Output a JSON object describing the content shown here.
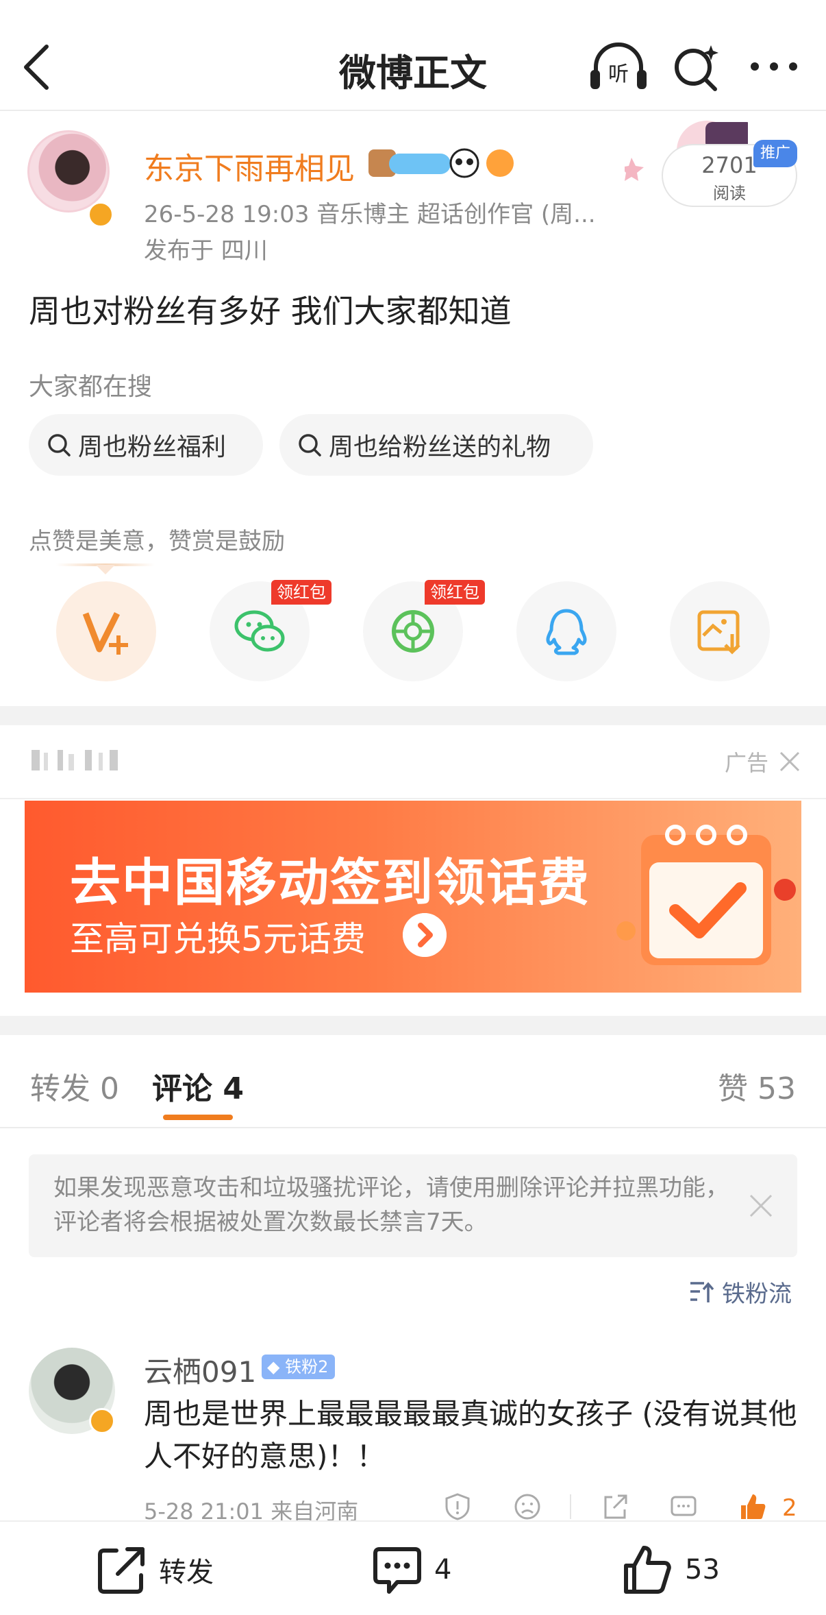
{
  "header": {
    "title": "微博正文",
    "icons": [
      "back-icon",
      "listen-icon",
      "search-spark-icon",
      "more-icon"
    ],
    "listen_glyph": "听"
  },
  "author": {
    "name": "东京下雨再相见",
    "timestamp_source": "26-5-28 19:03  音乐博主 超话创作官 (周...",
    "location": "发布于 四川",
    "reads_count": "2701",
    "reads_label": "阅读",
    "promo_tag": "推广"
  },
  "post": {
    "text": "周也对粉丝有多好 我们大家都知道"
  },
  "search": {
    "heading": "大家都在搜",
    "chips": [
      "周也粉丝福利",
      "周也给粉丝送的礼物"
    ]
  },
  "reward": {
    "text": "点赞是美意，赞赏是鼓励",
    "share_targets": [
      "v-plus-reward-icon",
      "wechat-icon",
      "moments-icon",
      "qq-icon",
      "save-image-icon"
    ],
    "red_packet_label": "领红包"
  },
  "ad": {
    "label": "广告",
    "title": "去中国移动签到领话费",
    "subtitle": "至高可兑换5元话费"
  },
  "tabs": {
    "repost": "转发 0",
    "comment": "评论 4",
    "likes": "赞 53"
  },
  "notice": {
    "text": "如果发现恶意攻击和垃圾骚扰评论，请使用删除评论并拉黑功能，评论者将会根据被处置次数最长禁言7天。"
  },
  "sort": {
    "label": "铁粉流"
  },
  "comment": {
    "user": "云栖091",
    "fan_badge": "铁粉2",
    "text": "周也是世界上最最最最最真诚的女孩子 (没有说其他人不好的意思)！！",
    "meta": "5-28 21:01 来自河南",
    "likes": "2"
  },
  "bottom_bar": {
    "repost_label": "转发",
    "comment_count": "4",
    "like_count": "53"
  },
  "colors": {
    "accent": "#f07c1e",
    "brand_blue": "#4a86e8",
    "red_packet": "#ee3a2b",
    "ad_orange": "#ff5a2e"
  }
}
